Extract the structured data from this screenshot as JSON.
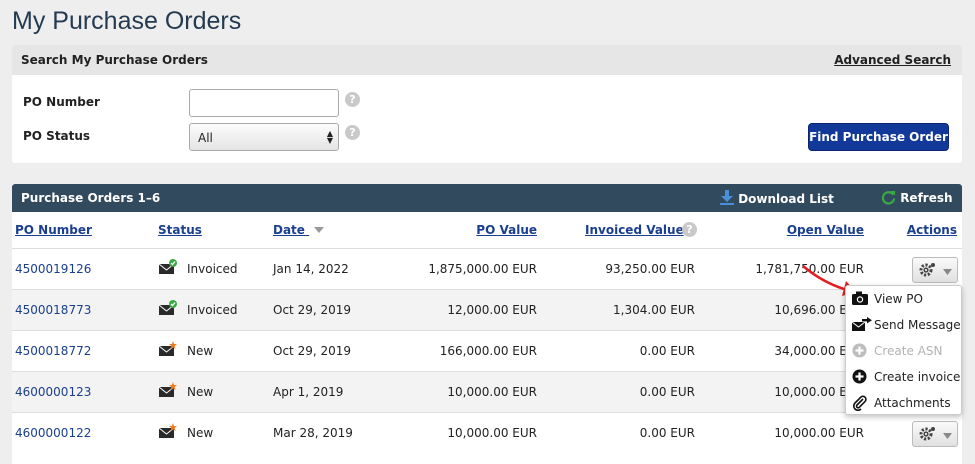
{
  "page": {
    "title": "My Purchase Orders"
  },
  "search": {
    "title": "Search My Purchase Orders",
    "advanced_link": "Advanced Search",
    "po_number_label": "PO Number",
    "po_number_value": "",
    "po_status_label": "PO Status",
    "po_status_value": "All",
    "help_glyph": "?",
    "find_button": "Find Purchase Order"
  },
  "results": {
    "title": "Purchase Orders 1–6",
    "download_label": "Download List",
    "refresh_label": "Refresh",
    "columns": {
      "po_number": "PO Number",
      "status": "Status",
      "date": "Date",
      "po_value": "PO Value",
      "invoiced_value": "Invoiced Value",
      "open_value": "Open Value",
      "actions": "Actions"
    },
    "rows": [
      {
        "po_number": "4500019126",
        "status": "Invoiced",
        "status_icon": "envelope-check-icon",
        "date": "Jan 14, 2022",
        "po_value": "1,875,000.00 EUR",
        "invoiced_value": "93,250.00 EUR",
        "open_value": "1,781,750.00 EUR"
      },
      {
        "po_number": "4500018773",
        "status": "Invoiced",
        "status_icon": "envelope-check-icon",
        "date": "Oct 29, 2019",
        "po_value": "12,000.00 EUR",
        "invoiced_value": "1,304.00 EUR",
        "open_value": "10,696.00 EUR"
      },
      {
        "po_number": "4500018772",
        "status": "New",
        "status_icon": "envelope-new-icon",
        "date": "Oct 29, 2019",
        "po_value": "166,000.00 EUR",
        "invoiced_value": "0.00 EUR",
        "open_value": "34,000.00 EUR"
      },
      {
        "po_number": "4600000123",
        "status": "New",
        "status_icon": "envelope-new-icon",
        "date": "Apr 1, 2019",
        "po_value": "10,000.00 EUR",
        "invoiced_value": "0.00 EUR",
        "open_value": "10,000.00 EUR"
      },
      {
        "po_number": "4600000122",
        "status": "New",
        "status_icon": "envelope-new-icon",
        "date": "Mar 28, 2019",
        "po_value": "10,000.00 EUR",
        "invoiced_value": "0.00 EUR",
        "open_value": "10,000.00 EUR"
      }
    ]
  },
  "actions_menu": {
    "items": [
      {
        "label": "View PO",
        "icon": "camera-icon",
        "enabled": true
      },
      {
        "label": "Send Message",
        "icon": "send-message-icon",
        "enabled": true
      },
      {
        "label": "Create ASN",
        "icon": "plus-circle-icon",
        "enabled": false
      },
      {
        "label": "Create invoice",
        "icon": "plus-circle-icon",
        "enabled": true
      },
      {
        "label": "Attachments",
        "icon": "paperclip-icon",
        "enabled": true
      }
    ]
  },
  "colors": {
    "title": "#243a51",
    "header_bar": "#314a5e",
    "link": "#1a3f8f",
    "primary_button": "#12389a",
    "status_check": "#3aa845",
    "status_new": "#f07a1a",
    "annotation_arrow": "#e02020",
    "refresh_icon": "#3aa845",
    "download_icon": "#4a90d9"
  }
}
